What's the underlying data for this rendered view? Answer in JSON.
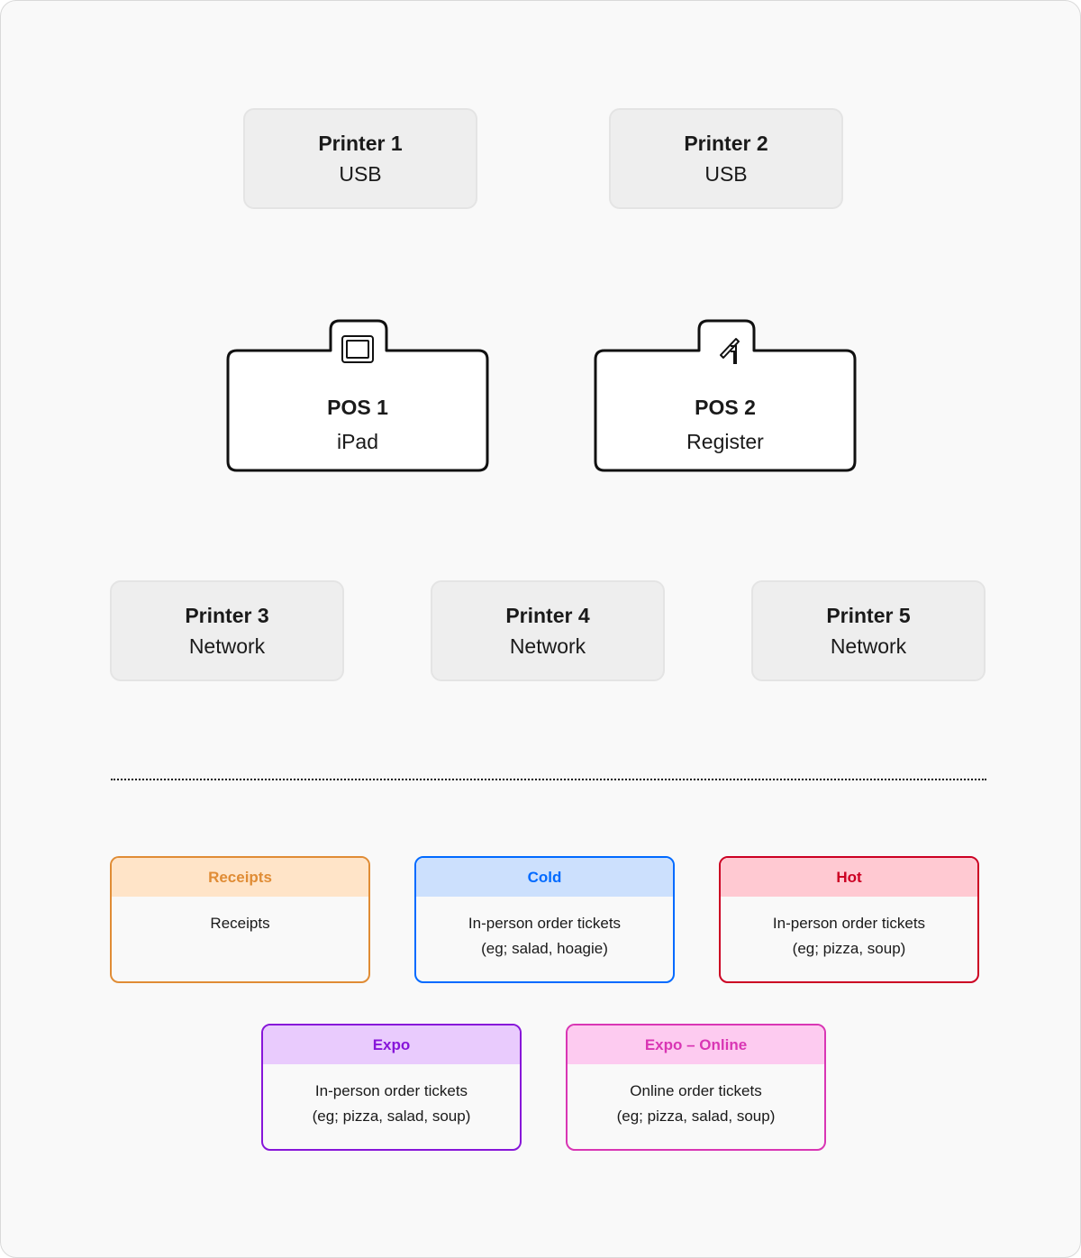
{
  "printers_usb": [
    {
      "name": "Printer 1",
      "connection": "USB"
    },
    {
      "name": "Printer 2",
      "connection": "USB"
    }
  ],
  "pos_devices": [
    {
      "name": "POS 1",
      "type": "iPad",
      "icon": "ipad-icon"
    },
    {
      "name": "POS 2",
      "type": "Register",
      "icon": "register-stand-icon"
    }
  ],
  "printers_network": [
    {
      "name": "Printer 3",
      "connection": "Network"
    },
    {
      "name": "Printer 4",
      "connection": "Network"
    },
    {
      "name": "Printer 5",
      "connection": "Network"
    }
  ],
  "routes": [
    {
      "title": "Receipts",
      "lines": [
        "Receipts",
        ""
      ],
      "color": "#e08c35",
      "header_bg": "#ffe4c8"
    },
    {
      "title": "Cold",
      "lines": [
        "In-person order tickets",
        "(eg; salad, hoagie)"
      ],
      "color": "#006aff",
      "header_bg": "#cce0fd"
    },
    {
      "title": "Hot",
      "lines": [
        "In-person order tickets",
        "(eg; pizza, soup)"
      ],
      "color": "#cc0023",
      "header_bg": "#ffc9d2"
    },
    {
      "title": "Expo",
      "lines": [
        "In-person order tickets",
        "(eg; pizza, salad, soup)"
      ],
      "color": "#8716d9",
      "header_bg": "#e9cbfd"
    },
    {
      "title": "Expo – Online",
      "lines": [
        "Online order tickets",
        "(eg; pizza, salad, soup)"
      ],
      "color": "#d936b4",
      "header_bg": "#fdcbf0"
    }
  ]
}
